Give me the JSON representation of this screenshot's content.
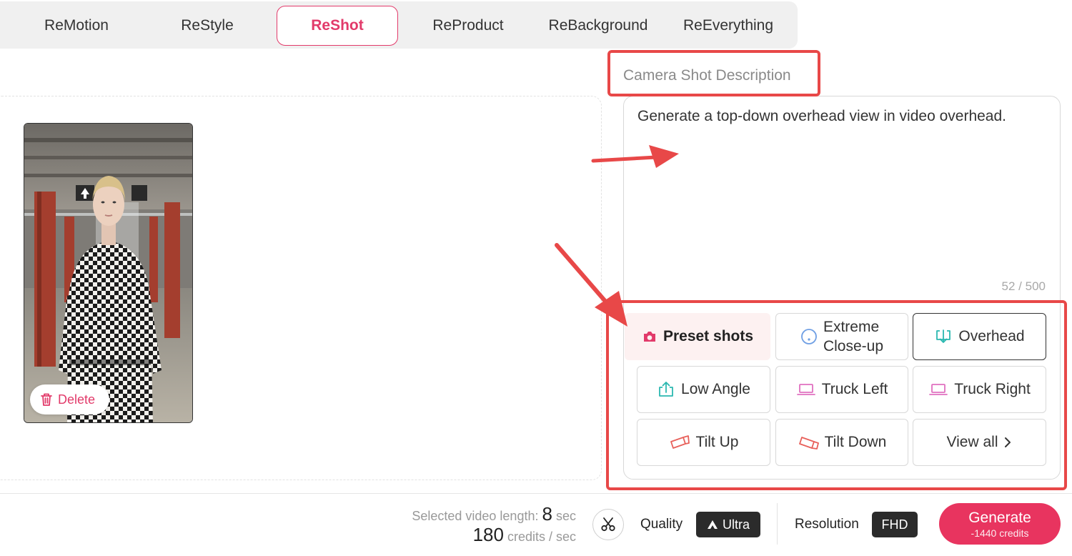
{
  "tabs": [
    {
      "label": "ReMotion",
      "active": false
    },
    {
      "label": "ReStyle",
      "active": false
    },
    {
      "label": "ReShot",
      "active": true
    },
    {
      "label": "ReProduct",
      "active": false
    },
    {
      "label": "ReBackground",
      "active": false
    },
    {
      "label": "ReEverything",
      "active": false
    }
  ],
  "media": {
    "delete_label": "Delete"
  },
  "description": {
    "label": "Camera Shot Description",
    "text": "Generate a top-down overhead view in video overhead.",
    "count": "52 / 500"
  },
  "shots": {
    "preset_label": "Preset shots",
    "extreme_line1": "Extreme",
    "extreme_line2": "Close-up",
    "overhead": "Overhead",
    "low_angle": "Low Angle",
    "truck_left": "Truck Left",
    "truck_right": "Truck Right",
    "tilt_up": "Tilt Up",
    "tilt_down": "Tilt Down",
    "view_all": "View all"
  },
  "footer": {
    "length_label": "Selected video length:",
    "length_value": "8",
    "length_unit": "sec",
    "credits_value": "180",
    "credits_unit": "credits / sec",
    "quality_label": "Quality",
    "quality_value": "Ultra",
    "resolution_label": "Resolution",
    "resolution_value": "FHD",
    "generate_label": "Generate",
    "generate_cost": "-1440 credits"
  },
  "colors": {
    "accent": "#e8345f",
    "annotation": "#e84848",
    "teal_icon": "#2bb8b0",
    "pink_icon": "#e070c0"
  }
}
